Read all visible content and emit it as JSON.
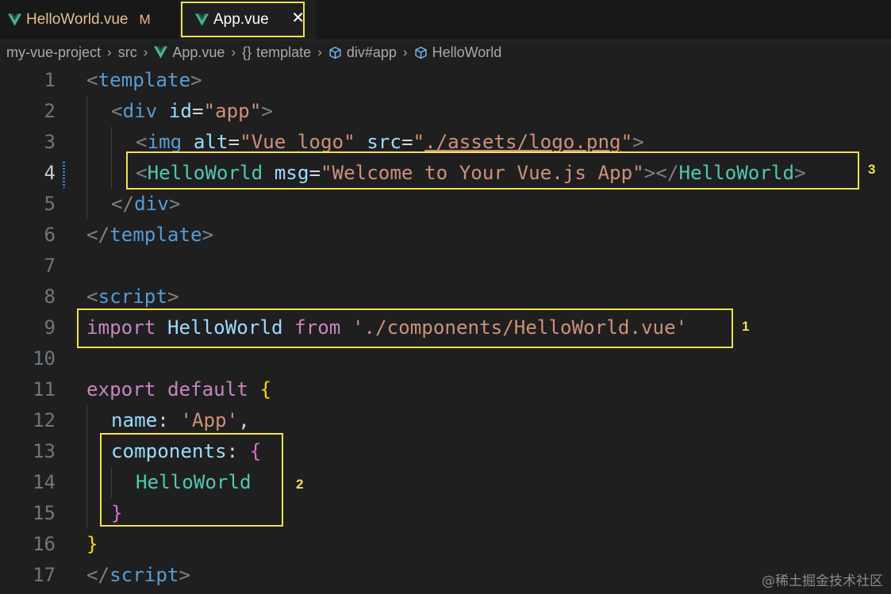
{
  "tabs": [
    {
      "label": "HelloWorld.vue",
      "badge": "M",
      "icon": "vue-logo-icon"
    },
    {
      "label": "App.vue",
      "close": "✕",
      "icon": "vue-logo-icon"
    }
  ],
  "breadcrumb": {
    "project": "my-vue-project",
    "folder": "src",
    "file": "App.vue",
    "braces": "{}",
    "template": "template",
    "div": "div#app",
    "component": "HelloWorld"
  },
  "lines": [
    "1",
    "2",
    "3",
    "4",
    "5",
    "6",
    "7",
    "8",
    "9",
    "10",
    "11",
    "12",
    "13",
    "14",
    "15",
    "16",
    "17"
  ],
  "code": {
    "l1": {
      "lt": "<",
      "tag": "template",
      "gt": ">"
    },
    "l2": {
      "lt": "<",
      "tag": "div",
      "attr": "id",
      "eq": "=",
      "val": "\"app\"",
      "gt": ">"
    },
    "l3": {
      "lt": "<",
      "tag": "img",
      "attr1": "alt",
      "eq1": "=",
      "val1": "\"Vue logo\"",
      "attr2": "src",
      "eq2": "=",
      "q1": "\"",
      "path": "./assets/logo.png",
      "q2": "\"",
      "gt": ">"
    },
    "l4": {
      "lt": "<",
      "tag": "HelloWorld",
      "attr": "msg",
      "eq": "=",
      "val": "\"Welcome to Your Vue.js App\"",
      "mid": "></",
      "tag2": "HelloWorld",
      "gt": ">"
    },
    "l5": {
      "lt": "</",
      "tag": "div",
      "gt": ">"
    },
    "l6": {
      "lt": "</",
      "tag": "template",
      "gt": ">"
    },
    "l8": {
      "lt": "<",
      "tag": "script",
      "gt": ">"
    },
    "l9": {
      "kw1": "import",
      "id": "HelloWorld",
      "kw2": "from",
      "str": "'./components/HelloWorld.vue'"
    },
    "l11": {
      "kw1": "export",
      "kw2": "default",
      "brace": "{"
    },
    "l12": {
      "key": "name",
      "colon": ":",
      "str": "'App'",
      "comma": ","
    },
    "l13": {
      "key": "components",
      "colon": ":",
      "brace": "{"
    },
    "l14": {
      "comp": "HelloWorld"
    },
    "l15": {
      "brace": "}"
    },
    "l16": {
      "brace": "}"
    },
    "l17": {
      "lt": "</",
      "tag": "script",
      "gt": ">"
    }
  },
  "annotations": {
    "a1": "1",
    "a2": "2",
    "a3": "3"
  },
  "watermark": "@稀土掘金技术社区",
  "colors": {
    "highlight": "#f4e14d",
    "vue_green": "#41b883"
  }
}
